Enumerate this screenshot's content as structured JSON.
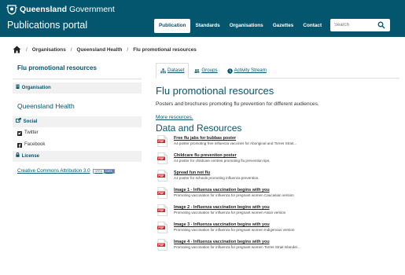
{
  "header": {
    "gov_bold": "Queensland",
    "gov_rest": " Government",
    "portal_title": "Publications portal",
    "nav": [
      "Publication",
      "Standards",
      "Organisations",
      "Gazettes",
      "Contact"
    ],
    "active_nav": 0,
    "search_placeholder": "Search"
  },
  "breadcrumb": {
    "items": [
      "Organisations",
      "Queensland Health",
      "Flu promotional resources"
    ],
    "separator": "/"
  },
  "sidebar": {
    "title": "Flu promotional resources",
    "organisation_label": "Organisation",
    "org_name": "Queensland Health",
    "social_label": "Social",
    "twitter": "Twitter",
    "facebook": "Facebook",
    "license_label": "License",
    "license_link": "Creative Commons Attribution 3.0",
    "badge_left": "OPEN",
    "badge_right": "DATA"
  },
  "tabs": [
    "Dataset",
    "Groups",
    "Activity Stream"
  ],
  "main": {
    "title": "Flu promotional resources",
    "description": "Posters and brochures promoting flu prevention for different audiences.",
    "more_link": "More resources.",
    "resources_heading": "Data and Resources",
    "resources": [
      {
        "title": "Free flu jabs for bubbas poster",
        "desc": "A4 poster promoting free influenza vaccines for Aboriginal and Torres Strait..."
      },
      {
        "title": "Childcare flu prevention poster",
        "desc": "A4 poster for childcare centres promoting flu prevention tips."
      },
      {
        "title": "Spread fun not flu",
        "desc": "A4 poster for schools promoting influenza prevention."
      },
      {
        "title": "Image 1 - Influenza vaccination begins with you",
        "desc": "Promoting vaccination for influenza for pregnant women Caucasian version"
      },
      {
        "title": "Image 2 - Influenza vaccination begins with you",
        "desc": "Promoting vaccination for influenza for pregnant women Asian version"
      },
      {
        "title": "Image 3 - Influenza vaccination begins with you",
        "desc": "Promoting vaccination for influenza for pregnant women Indigenous version"
      },
      {
        "title": "Image 4 - Influenza vaccination begins with you",
        "desc": "Promoting vaccination for influenza for pregnant women Torres Strait Islander..."
      }
    ]
  },
  "colors": {
    "brand": "#04566e",
    "pdf_red": "#d9262c",
    "section_bg": "#f1f1f1"
  },
  "icons": {
    "crest": "qld-crest-icon",
    "search": "search-icon",
    "home": "home-icon",
    "organisation": "building-icon",
    "social": "share-icon",
    "twitter": "twitter-icon",
    "facebook": "facebook-icon",
    "license": "lock-icon",
    "dataset": "sitemap-icon",
    "groups": "users-icon",
    "activity": "clock-icon",
    "resource": "pdf-file-icon"
  }
}
